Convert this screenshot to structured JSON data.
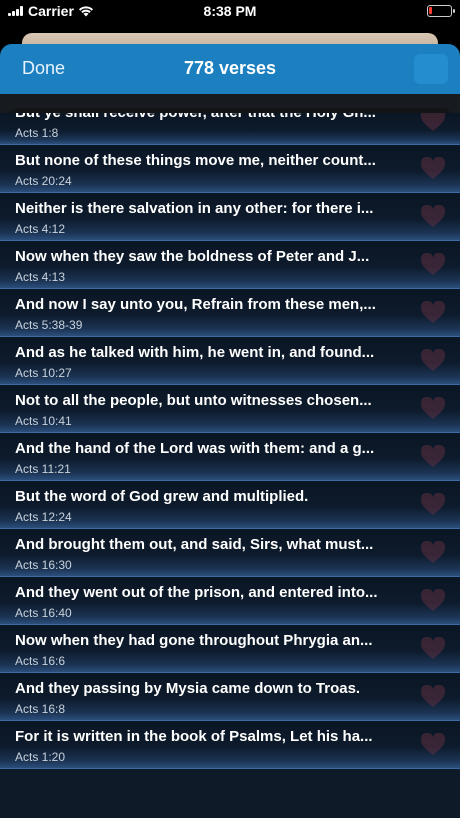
{
  "status_bar": {
    "carrier": "Carrier",
    "time": "8:38 PM"
  },
  "nav": {
    "done_label": "Done",
    "title": "778 verses"
  },
  "search": {
    "placeholder": ""
  },
  "colors": {
    "accent": "#1c7fbf",
    "battery_low": "#ff3b30"
  },
  "icons": {
    "search": "search-icon",
    "favorite": "heart-icon",
    "wifi": "wifi-icon",
    "battery": "battery-icon"
  },
  "verses": [
    {
      "text": "But ye shall receive power, after that the Holy Gh...",
      "ref": "Acts 1:8"
    },
    {
      "text": "But none of these things move me, neither count...",
      "ref": "Acts 20:24"
    },
    {
      "text": "Neither is there salvation in any other: for there i...",
      "ref": "Acts 4:12"
    },
    {
      "text": "Now when they saw the boldness of Peter and J...",
      "ref": "Acts 4:13"
    },
    {
      "text": "And now I say unto you, Refrain from these men,...",
      "ref": "Acts 5:38-39"
    },
    {
      "text": "And as he talked with him, he went in, and found...",
      "ref": "Acts 10:27"
    },
    {
      "text": "Not to all the people, but unto witnesses chosen...",
      "ref": "Acts 10:41"
    },
    {
      "text": "And the hand of the Lord was with them: and a g...",
      "ref": "Acts 11:21"
    },
    {
      "text": "But the word of God grew and multiplied.",
      "ref": "Acts 12:24"
    },
    {
      "text": "And brought them out, and said, Sirs, what must...",
      "ref": "Acts 16:30"
    },
    {
      "text": "And they went out of the prison, and entered into...",
      "ref": "Acts 16:40"
    },
    {
      "text": "Now when they had gone throughout Phrygia an...",
      "ref": "Acts 16:6"
    },
    {
      "text": "And they passing by Mysia came down to Troas.",
      "ref": "Acts 16:8"
    },
    {
      "text": "For it is written in the book of Psalms, Let his ha...",
      "ref": "Acts 1:20"
    }
  ]
}
